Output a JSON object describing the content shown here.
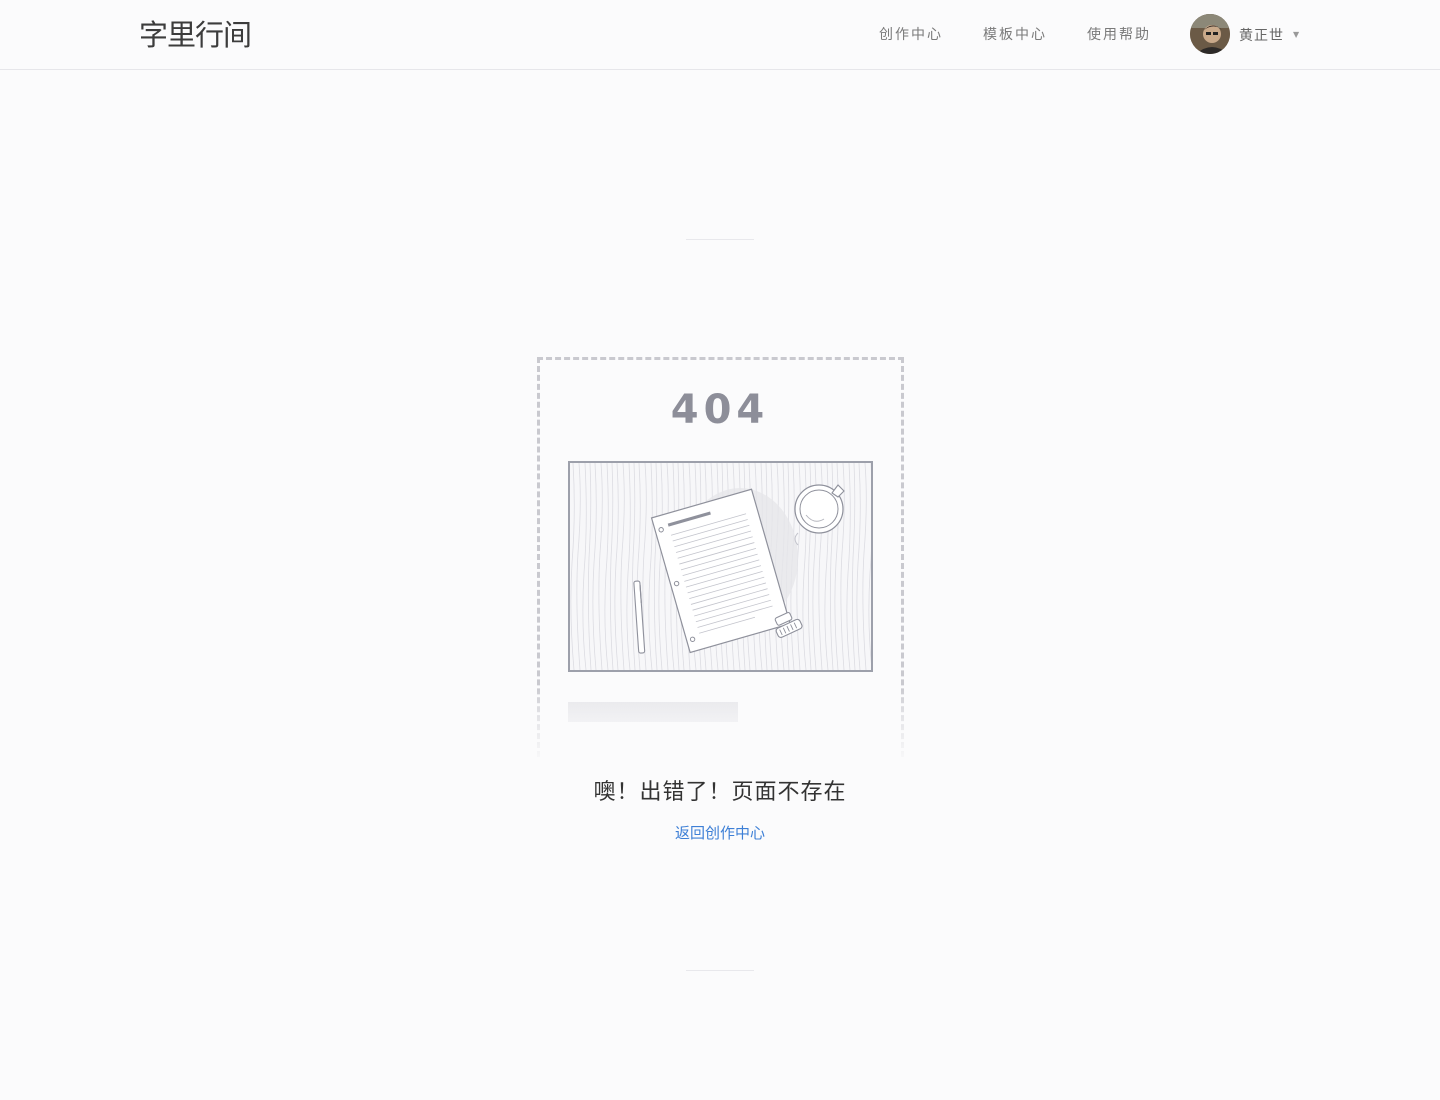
{
  "header": {
    "logo": "字里行间",
    "nav": [
      {
        "label": "创作中心"
      },
      {
        "label": "模板中心"
      },
      {
        "label": "使用帮助"
      }
    ],
    "user": {
      "name": "黄正世",
      "caret": "▼"
    }
  },
  "error": {
    "code": "404",
    "message": "噢！出错了！页面不存在",
    "back_link": "返回创作中心"
  },
  "colors": {
    "accent_link": "#3d7fd6",
    "code_gray": "#8d8e99",
    "background": "#fbfbfc"
  }
}
